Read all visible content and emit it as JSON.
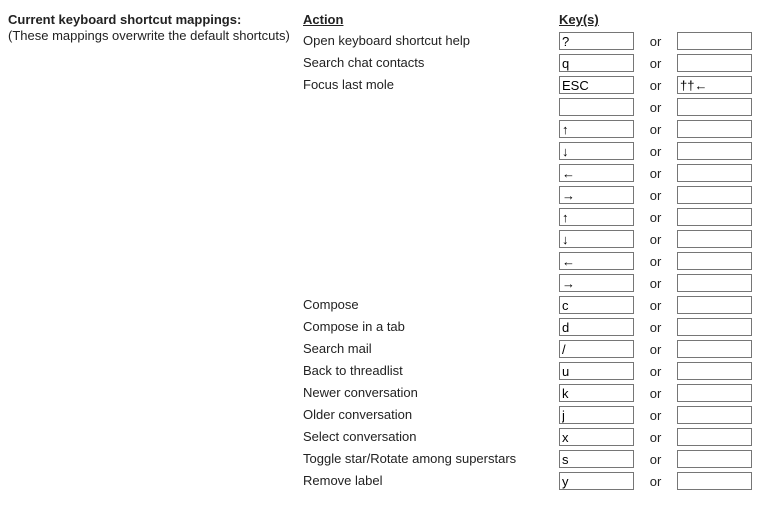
{
  "left": {
    "title": "Current keyboard shortcut mappings:",
    "subtitle": "(These mappings overwrite the default shortcuts)"
  },
  "headers": {
    "action": "Action",
    "keys": "Key(s)"
  },
  "or_label": "or",
  "rows": [
    {
      "action": "Open keyboard shortcut help",
      "k1": "?",
      "k2": ""
    },
    {
      "action": "Search chat contacts",
      "k1": "q",
      "k2": ""
    },
    {
      "action": "Focus last mole",
      "k1": "ESC",
      "k2": "††←"
    },
    {
      "action": "",
      "k1": "",
      "k2": ""
    },
    {
      "action": "",
      "k1": "↑",
      "k2": ""
    },
    {
      "action": "",
      "k1": "↓",
      "k2": ""
    },
    {
      "action": "",
      "k1": "←",
      "k2": ""
    },
    {
      "action": "",
      "k1": "→",
      "k2": ""
    },
    {
      "action": "",
      "k1": "↑",
      "k2": ""
    },
    {
      "action": "",
      "k1": "↓",
      "k2": ""
    },
    {
      "action": "",
      "k1": "←",
      "k2": ""
    },
    {
      "action": "",
      "k1": "→",
      "k2": ""
    },
    {
      "action": "Compose",
      "k1": "c",
      "k2": ""
    },
    {
      "action": "Compose in a tab",
      "k1": "d",
      "k2": ""
    },
    {
      "action": "Search mail",
      "k1": "/",
      "k2": ""
    },
    {
      "action": "Back to threadlist",
      "k1": "u",
      "k2": ""
    },
    {
      "action": "Newer conversation",
      "k1": "k",
      "k2": ""
    },
    {
      "action": "Older conversation",
      "k1": "j",
      "k2": ""
    },
    {
      "action": "Select conversation",
      "k1": "x",
      "k2": ""
    },
    {
      "action": "Toggle star/Rotate among superstars",
      "k1": "s",
      "k2": ""
    },
    {
      "action": "Remove label",
      "k1": "y",
      "k2": ""
    }
  ]
}
